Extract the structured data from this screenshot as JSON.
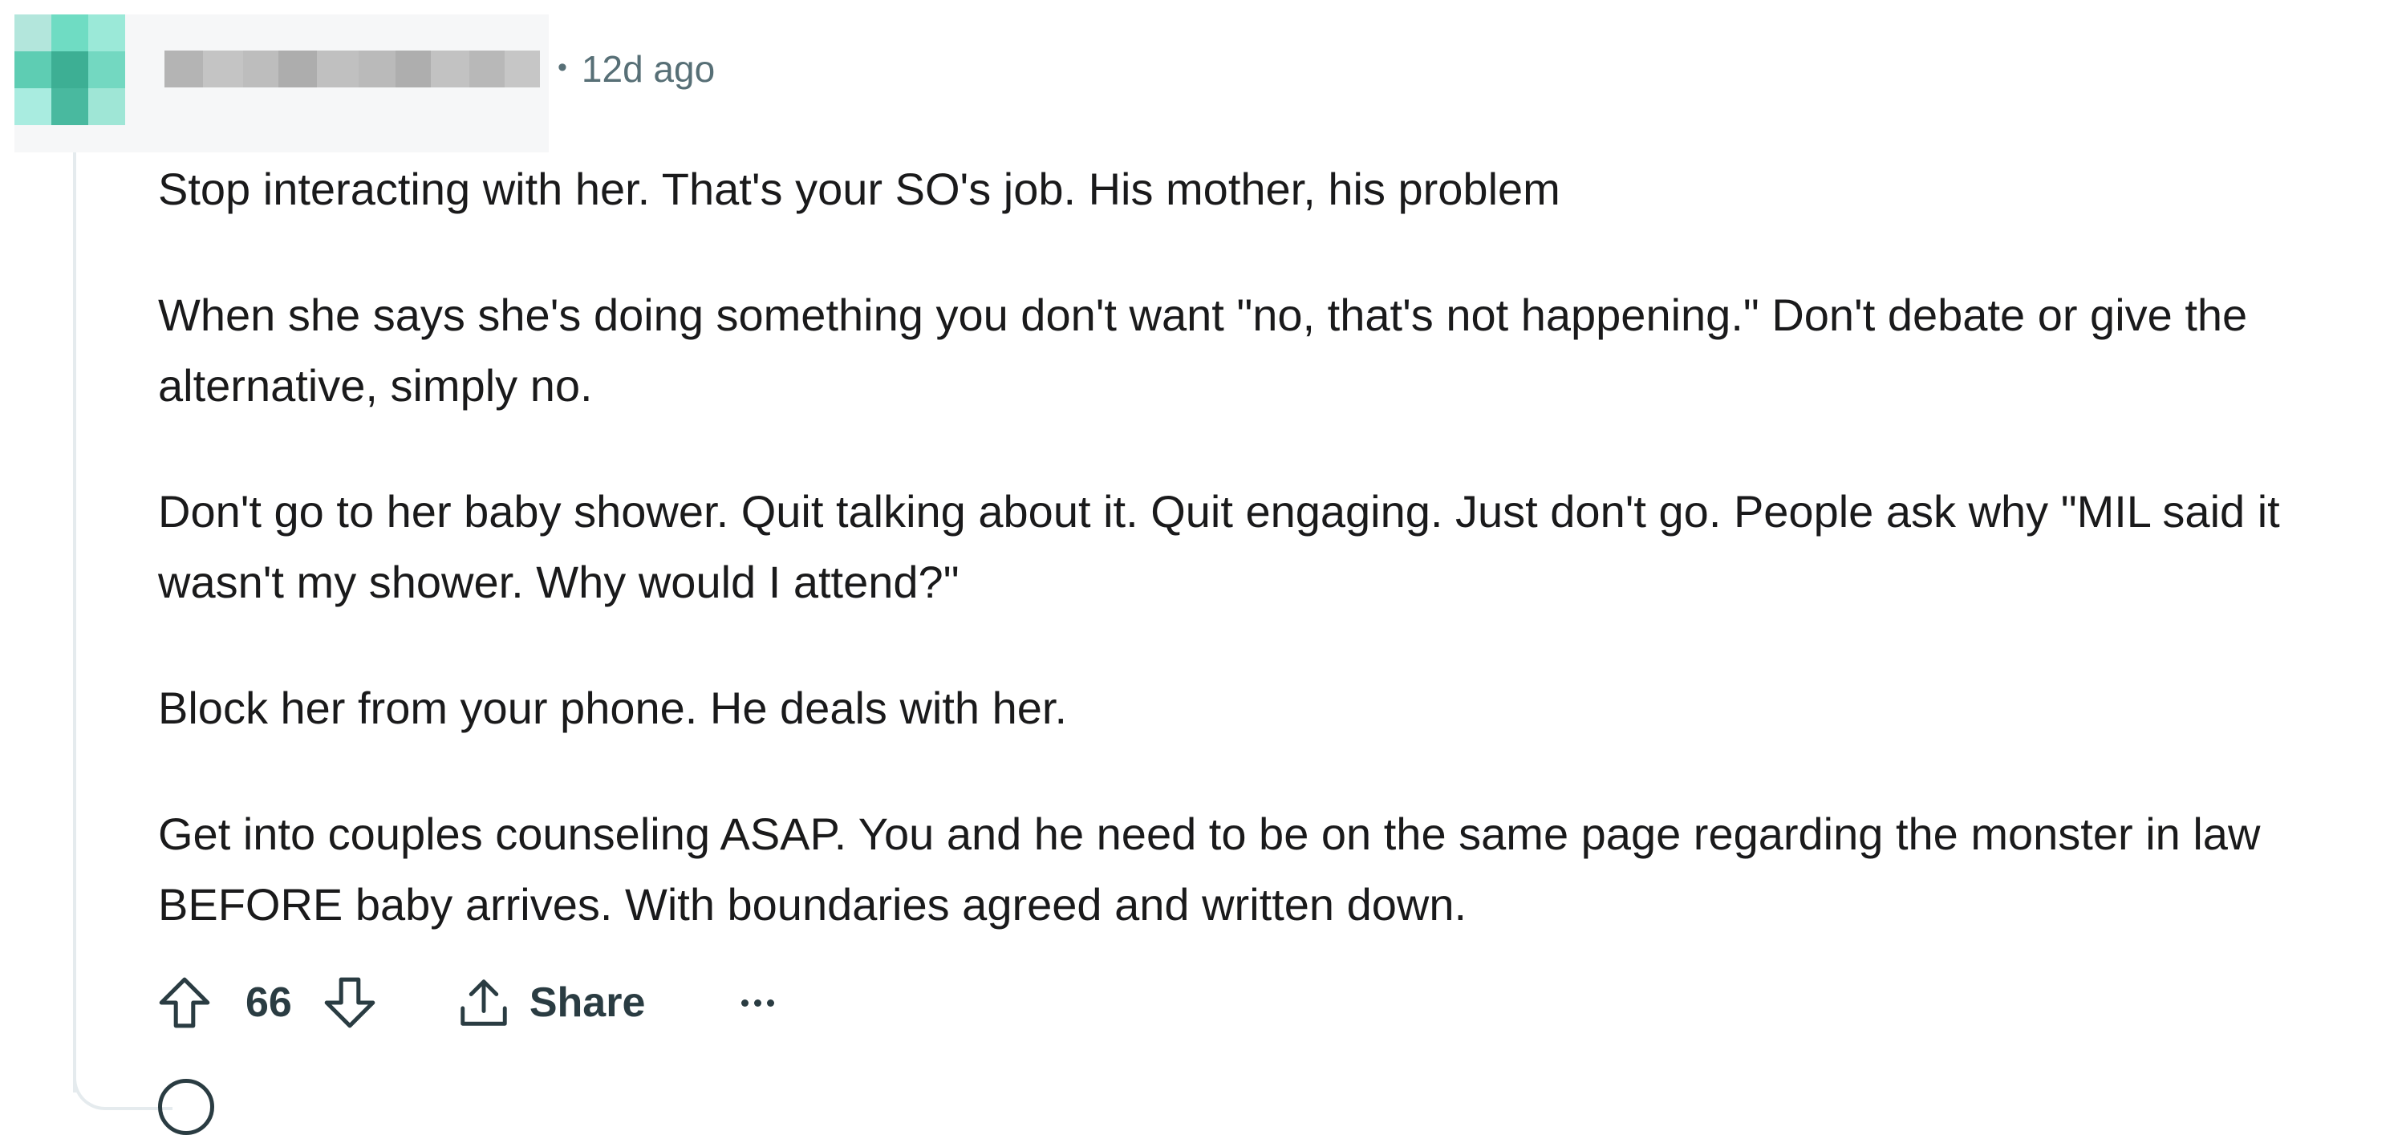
{
  "comment": {
    "timestamp": "12d ago",
    "separator": "•",
    "paragraphs": [
      "Stop interacting with her. That's your SO's job. His mother, his problem",
      "When she says she's doing something you don't want \"no, that's not happening.\" Don't debate or give the alternative, simply no.",
      "Don't go to her baby shower. Quit talking about it. Quit engaging. Just don't go. People ask why \"MIL said it wasn't my shower. Why would I attend?\"",
      "Block her from your phone. He deals with her.",
      "Get into couples counseling ASAP. You and he need to be on the same page regarding the monster in law BEFORE baby arrives. With boundaries agreed and written down."
    ],
    "vote_count": "66",
    "share_label": "Share"
  },
  "icons": {
    "upvote": "arrow-up-outline-icon",
    "downvote": "arrow-down-outline-icon",
    "share": "share-upload-icon",
    "more": "ellipsis-icon",
    "reply": "speech-bubble-icon"
  },
  "colors": {
    "meta_text": "#576f76",
    "action_text": "#2a3c42",
    "body_text": "#1a1a1b",
    "thread_line": "#e5ebee"
  }
}
